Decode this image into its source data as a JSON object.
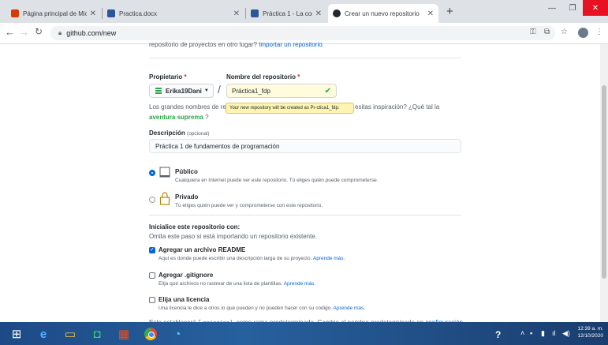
{
  "browser": {
    "tabs": [
      {
        "label": "Página principal de Microsoft Of",
        "color": "#d83b01"
      },
      {
        "label": "Practica.docx",
        "color": "#2b579a"
      },
      {
        "label": "Práctica 1 - La computación com",
        "color": "#2b579a"
      },
      {
        "label": "Crear un nuevo repositorio",
        "color": "#24292e"
      }
    ],
    "url": "github.com/new"
  },
  "page": {
    "intro_text": "repositorio de proyectos en otro lugar?",
    "import_link": "Importar un repositorio.",
    "owner_label": "Propietario",
    "repo_label": "Nombre del repositorio",
    "required_mark": "*",
    "owner_value": "Erika19Dani",
    "slash": "/",
    "repo_value": "Práctica1_fdp",
    "tooltip": "Your new repository will be created as Pr-ctica1_fdp.",
    "names_text_a": "Los grandes nombres de rep",
    "names_text_b": "esitas inspiración? ¿Qué tal la",
    "names_link": "aventura suprema",
    "names_end": "?",
    "desc_label": "Descripción",
    "desc_optional": "(opcional)",
    "desc_value": "Práctica 1 de fundamentos de programación",
    "public_title": "Público",
    "public_desc": "Cualquiera en Internet puede ver este repositorio. Tú eliges quién puede comprometerse.",
    "private_title": "Privado",
    "private_desc": "Tú eliges quién puede ver y comprometerse con este repositorio.",
    "init_title": "Inicialice este repositorio con:",
    "init_desc": "Omita este paso si está importando un repositorio existente.",
    "readme_title": "Agregar un archivo README",
    "readme_desc": "Aquí es donde puede escribir una descripción larga de su proyecto.",
    "gitignore_title": "Agregar .gitignore",
    "gitignore_desc": "Elija qué archivos no rastrear de una lista de plantillas.",
    "license_title": "Elija una licencia",
    "license_desc": "Una licencia le dice a otros lo que pueden y no pueden hacer con su código.",
    "learn_more": "Aprende más.",
    "branch_text_a": "Esto establecerá",
    "branch_name": "principal",
    "branch_text_b": "como rama predeterminada. Cambie el nombre predeterminado en",
    "branch_link": "configuración",
    "branch_end": "."
  },
  "taskbar": {
    "time": "12:39 a. m.",
    "date": "12/10/2020"
  }
}
